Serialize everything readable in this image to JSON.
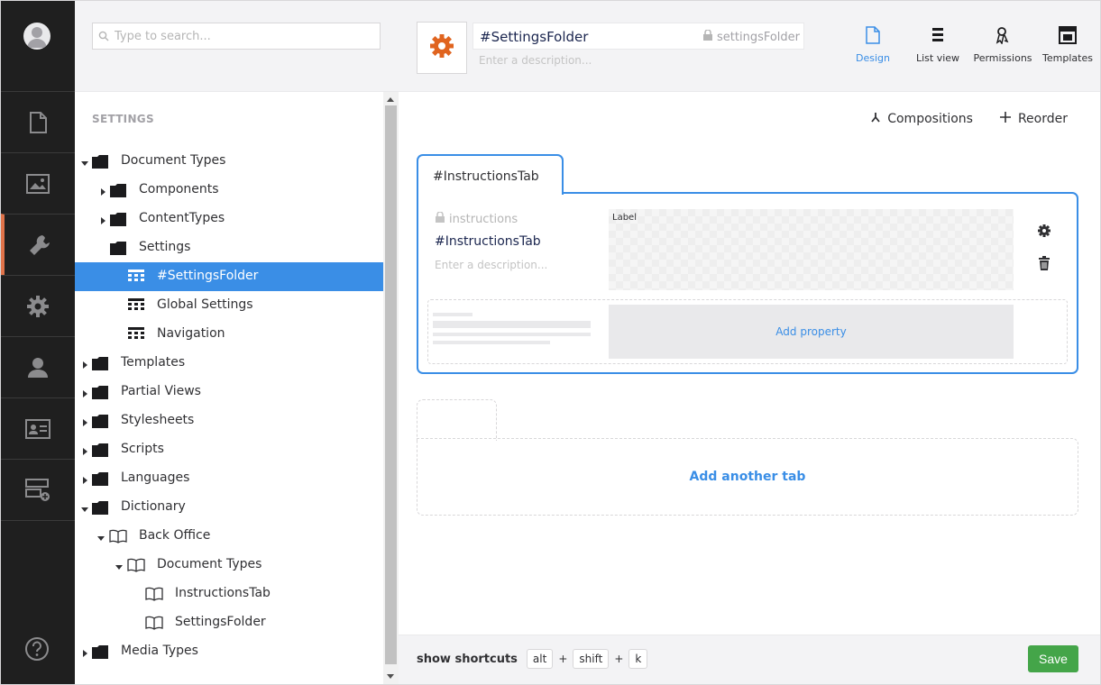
{
  "search": {
    "placeholder": "Type to search..."
  },
  "tree": {
    "section_title": "SETTINGS",
    "nodes": [
      {
        "label": "Document Types"
      },
      {
        "label": "Components"
      },
      {
        "label": "ContentTypes"
      },
      {
        "label": "Settings"
      },
      {
        "label": "#SettingsFolder"
      },
      {
        "label": "Global Settings"
      },
      {
        "label": "Navigation"
      },
      {
        "label": "Templates"
      },
      {
        "label": "Partial Views"
      },
      {
        "label": "Stylesheets"
      },
      {
        "label": "Scripts"
      },
      {
        "label": "Languages"
      },
      {
        "label": "Dictionary"
      },
      {
        "label": "Back Office"
      },
      {
        "label": "Document Types"
      },
      {
        "label": "InstructionsTab"
      },
      {
        "label": "SettingsFolder"
      },
      {
        "label": "Media Types"
      }
    ]
  },
  "header": {
    "name": "#SettingsFolder",
    "alias": "settingsFolder",
    "description_placeholder": "Enter a description...",
    "apps": [
      {
        "label": "Design"
      },
      {
        "label": "List view"
      },
      {
        "label": "Permissions"
      },
      {
        "label": "Templates"
      }
    ]
  },
  "toolbar": {
    "compositions": "Compositions",
    "reorder": "Reorder"
  },
  "tab": {
    "name": "#InstructionsTab",
    "property": {
      "alias": "instructions",
      "name": "#InstructionsTab",
      "description_placeholder": "Enter a description...",
      "preview_label": "Label"
    },
    "add_property": "Add property"
  },
  "add_tab": "Add another tab",
  "footer": {
    "shortcuts_label": "show shortcuts",
    "keys": [
      "alt",
      "shift",
      "k"
    ],
    "save": "Save"
  },
  "colors": {
    "accent": "#3a8ee6",
    "save": "#44a549",
    "icon": "#e0734a",
    "rail": "#1f1f1f"
  }
}
